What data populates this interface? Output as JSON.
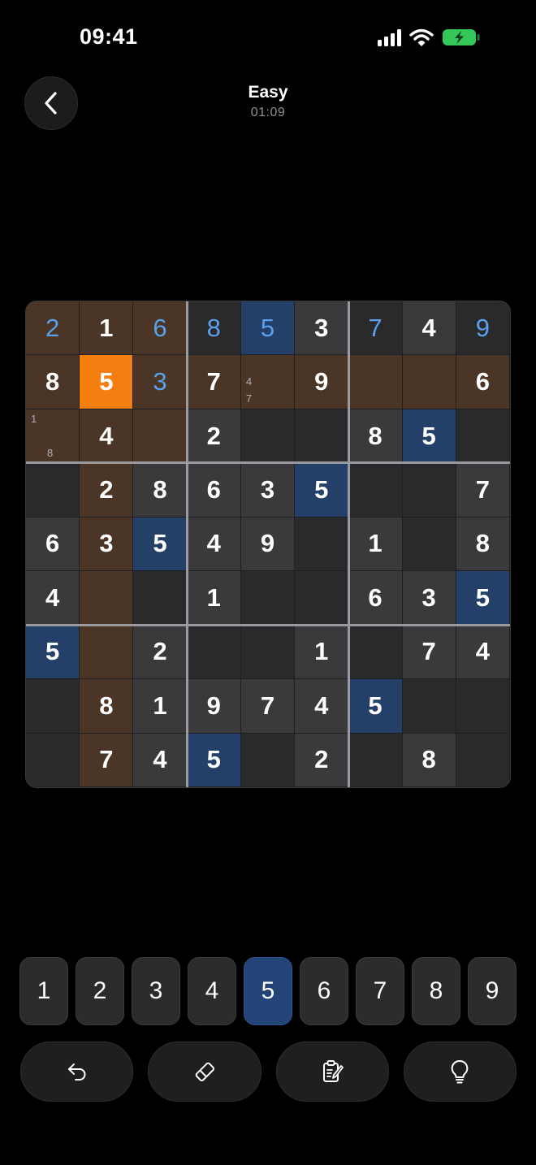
{
  "status_bar": {
    "time": "09:41"
  },
  "header": {
    "title": "Easy",
    "timer": "01:09"
  },
  "board": {
    "cells": [
      [
        {
          "v": "2",
          "t": "user",
          "bg": "brown"
        },
        {
          "v": "1",
          "t": "given",
          "bg": "brown"
        },
        {
          "v": "6",
          "t": "user",
          "bg": "brown"
        },
        {
          "v": "8",
          "t": "user",
          "bg": "dark"
        },
        {
          "v": "5",
          "t": "user",
          "bg": "blue"
        },
        {
          "v": "3",
          "t": "given",
          "bg": "light"
        },
        {
          "v": "7",
          "t": "user",
          "bg": "dark"
        },
        {
          "v": "4",
          "t": "given",
          "bg": "light"
        },
        {
          "v": "9",
          "t": "user",
          "bg": "dark"
        }
      ],
      [
        {
          "v": "8",
          "t": "given",
          "bg": "brown"
        },
        {
          "v": "5",
          "t": "sel",
          "bg": "orange"
        },
        {
          "v": "3",
          "t": "user",
          "bg": "brown"
        },
        {
          "v": "7",
          "t": "given",
          "bg": "brown"
        },
        {
          "v": "",
          "t": "",
          "bg": "brown",
          "notes": [
            "4",
            "7"
          ]
        },
        {
          "v": "9",
          "t": "given",
          "bg": "brown"
        },
        {
          "v": "",
          "t": "",
          "bg": "brown"
        },
        {
          "v": "",
          "t": "",
          "bg": "brown"
        },
        {
          "v": "6",
          "t": "given",
          "bg": "brown"
        }
      ],
      [
        {
          "v": "",
          "t": "",
          "bg": "brown",
          "notes": [
            "1",
            "8"
          ]
        },
        {
          "v": "4",
          "t": "given",
          "bg": "brown"
        },
        {
          "v": "",
          "t": "",
          "bg": "brown"
        },
        {
          "v": "2",
          "t": "given",
          "bg": "light"
        },
        {
          "v": "",
          "t": "",
          "bg": "dark"
        },
        {
          "v": "",
          "t": "",
          "bg": "dark"
        },
        {
          "v": "8",
          "t": "given",
          "bg": "light"
        },
        {
          "v": "5",
          "t": "given",
          "bg": "blue"
        },
        {
          "v": "",
          "t": "",
          "bg": "dark"
        }
      ],
      [
        {
          "v": "",
          "t": "",
          "bg": "dark"
        },
        {
          "v": "2",
          "t": "given",
          "bg": "brown"
        },
        {
          "v": "8",
          "t": "given",
          "bg": "light"
        },
        {
          "v": "6",
          "t": "given",
          "bg": "light"
        },
        {
          "v": "3",
          "t": "given",
          "bg": "light"
        },
        {
          "v": "5",
          "t": "given",
          "bg": "blue"
        },
        {
          "v": "",
          "t": "",
          "bg": "dark"
        },
        {
          "v": "",
          "t": "",
          "bg": "dark"
        },
        {
          "v": "7",
          "t": "given",
          "bg": "light"
        }
      ],
      [
        {
          "v": "6",
          "t": "given",
          "bg": "light"
        },
        {
          "v": "3",
          "t": "given",
          "bg": "brown"
        },
        {
          "v": "5",
          "t": "given",
          "bg": "blue"
        },
        {
          "v": "4",
          "t": "given",
          "bg": "light"
        },
        {
          "v": "9",
          "t": "given",
          "bg": "light"
        },
        {
          "v": "",
          "t": "",
          "bg": "dark"
        },
        {
          "v": "1",
          "t": "given",
          "bg": "light"
        },
        {
          "v": "",
          "t": "",
          "bg": "dark"
        },
        {
          "v": "8",
          "t": "given",
          "bg": "light"
        }
      ],
      [
        {
          "v": "4",
          "t": "given",
          "bg": "light"
        },
        {
          "v": "",
          "t": "",
          "bg": "brown"
        },
        {
          "v": "",
          "t": "",
          "bg": "dark"
        },
        {
          "v": "1",
          "t": "given",
          "bg": "light"
        },
        {
          "v": "",
          "t": "",
          "bg": "dark"
        },
        {
          "v": "",
          "t": "",
          "bg": "dark"
        },
        {
          "v": "6",
          "t": "given",
          "bg": "light"
        },
        {
          "v": "3",
          "t": "given",
          "bg": "light"
        },
        {
          "v": "5",
          "t": "given",
          "bg": "blue"
        }
      ],
      [
        {
          "v": "5",
          "t": "given",
          "bg": "blue"
        },
        {
          "v": "",
          "t": "",
          "bg": "brown"
        },
        {
          "v": "2",
          "t": "given",
          "bg": "light"
        },
        {
          "v": "",
          "t": "",
          "bg": "dark"
        },
        {
          "v": "",
          "t": "",
          "bg": "dark"
        },
        {
          "v": "1",
          "t": "given",
          "bg": "light"
        },
        {
          "v": "",
          "t": "",
          "bg": "dark"
        },
        {
          "v": "7",
          "t": "given",
          "bg": "light"
        },
        {
          "v": "4",
          "t": "given",
          "bg": "light"
        }
      ],
      [
        {
          "v": "",
          "t": "",
          "bg": "dark"
        },
        {
          "v": "8",
          "t": "given",
          "bg": "brown"
        },
        {
          "v": "1",
          "t": "given",
          "bg": "light"
        },
        {
          "v": "9",
          "t": "given",
          "bg": "light"
        },
        {
          "v": "7",
          "t": "given",
          "bg": "light"
        },
        {
          "v": "4",
          "t": "given",
          "bg": "light"
        },
        {
          "v": "5",
          "t": "given",
          "bg": "blue"
        },
        {
          "v": "",
          "t": "",
          "bg": "dark"
        },
        {
          "v": "",
          "t": "",
          "bg": "dark"
        }
      ],
      [
        {
          "v": "",
          "t": "",
          "bg": "dark"
        },
        {
          "v": "7",
          "t": "given",
          "bg": "brown"
        },
        {
          "v": "4",
          "t": "given",
          "bg": "light"
        },
        {
          "v": "5",
          "t": "given",
          "bg": "blue"
        },
        {
          "v": "",
          "t": "",
          "bg": "dark"
        },
        {
          "v": "2",
          "t": "given",
          "bg": "light"
        },
        {
          "v": "",
          "t": "",
          "bg": "dark"
        },
        {
          "v": "8",
          "t": "given",
          "bg": "light"
        },
        {
          "v": "",
          "t": "",
          "bg": "dark"
        }
      ]
    ]
  },
  "numpad": {
    "keys": [
      "1",
      "2",
      "3",
      "4",
      "5",
      "6",
      "7",
      "8",
      "9"
    ],
    "active": "5"
  },
  "actions": [
    {
      "name": "undo-button",
      "icon": "undo-icon"
    },
    {
      "name": "erase-button",
      "icon": "eraser-icon"
    },
    {
      "name": "notes-button",
      "icon": "notes-icon"
    },
    {
      "name": "hint-button",
      "icon": "lightbulb-icon"
    }
  ],
  "colors": {
    "selected_cell": "#f47f10",
    "highlight_region": "#4a3526",
    "same_number": "#244069",
    "user_entry_text": "#5aa0ea",
    "battery_green": "#34c759"
  }
}
